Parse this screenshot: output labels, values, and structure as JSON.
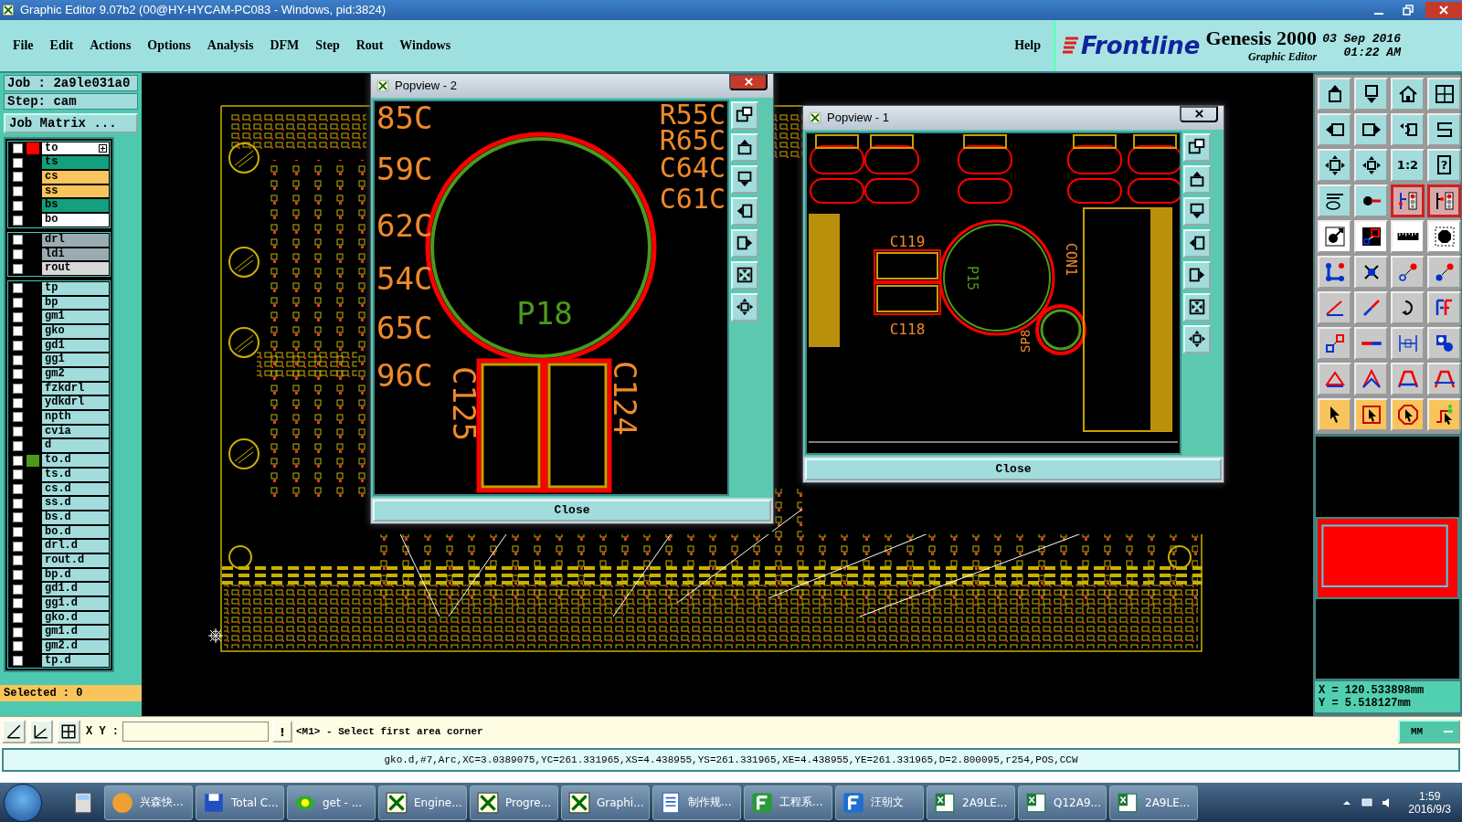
{
  "window": {
    "title": "Graphic Editor 9.07b2 (00@HY-HYCAM-PC083 - Windows, pid:3824)"
  },
  "menu": [
    "File",
    "Edit",
    "Actions",
    "Options",
    "Analysis",
    "DFM",
    "Step",
    "Rout",
    "Windows"
  ],
  "help": "Help",
  "brand": {
    "logo": "Frontline",
    "product": "Genesis 2000",
    "subtitle": "Graphic Editor",
    "date": "03 Sep 2016",
    "time": "01:22 AM"
  },
  "job": {
    "job": "Job : 2a9le031a0",
    "step": "Step: cam",
    "matrix_button": "Job Matrix ..."
  },
  "layer_groups": [
    [
      {
        "name": "to",
        "color": "#ffffff",
        "checked": false,
        "marker": {
          "color": "#ff0000"
        }
      },
      {
        "name": "ts",
        "color": "#13a07c",
        "checked": false
      },
      {
        "name": "cs",
        "color": "#f8c45c",
        "checked": false
      },
      {
        "name": "ss",
        "color": "#f8c45c",
        "checked": false
      },
      {
        "name": "bs",
        "color": "#13a07c",
        "checked": false
      },
      {
        "name": "bo",
        "color": "#ffffff",
        "checked": false
      }
    ],
    [
      {
        "name": "drl",
        "color": "#9aacb2",
        "checked": false
      },
      {
        "name": "ldi",
        "color": "#9aacb2",
        "checked": false
      },
      {
        "name": "rout",
        "color": "#d8d8d8",
        "checked": false
      }
    ],
    [
      {
        "name": "tp",
        "color": "#a2dcdc",
        "checked": false
      },
      {
        "name": "bp",
        "color": "#a2dcdc",
        "checked": false
      },
      {
        "name": "gm1",
        "color": "#a2dcdc",
        "checked": false
      },
      {
        "name": "gko",
        "color": "#a2dcdc",
        "checked": false
      },
      {
        "name": "gd1",
        "color": "#a2dcdc",
        "checked": false
      },
      {
        "name": "gg1",
        "color": "#a2dcdc",
        "checked": false
      },
      {
        "name": "gm2",
        "color": "#a2dcdc",
        "checked": false
      },
      {
        "name": "fzkdrl",
        "color": "#a2dcdc",
        "checked": false
      },
      {
        "name": "ydkdrl",
        "color": "#a2dcdc",
        "checked": false
      },
      {
        "name": "npth",
        "color": "#a2dcdc",
        "checked": false
      },
      {
        "name": "cvia",
        "color": "#a2dcdc",
        "checked": false
      },
      {
        "name": "d",
        "color": "#a2dcdc",
        "checked": false
      },
      {
        "name": "to.d",
        "color": "#a2dcdc",
        "checked": false,
        "marker": {
          "color": "#4c9a1a"
        }
      },
      {
        "name": "ts.d",
        "color": "#a2dcdc",
        "checked": false
      },
      {
        "name": "cs.d",
        "color": "#a2dcdc",
        "checked": false
      },
      {
        "name": "ss.d",
        "color": "#a2dcdc",
        "checked": false
      },
      {
        "name": "bs.d",
        "color": "#a2dcdc",
        "checked": false
      },
      {
        "name": "bo.d",
        "color": "#a2dcdc",
        "checked": false
      },
      {
        "name": "drl.d",
        "color": "#a2dcdc",
        "checked": false
      },
      {
        "name": "rout.d",
        "color": "#a2dcdc",
        "checked": false
      },
      {
        "name": "bp.d",
        "color": "#a2dcdc",
        "checked": false
      },
      {
        "name": "gd1.d",
        "color": "#a2dcdc",
        "checked": false
      },
      {
        "name": "gg1.d",
        "color": "#a2dcdc",
        "checked": false
      },
      {
        "name": "gko.d",
        "color": "#a2dcdc",
        "checked": false
      },
      {
        "name": "gm1.d",
        "color": "#a2dcdc",
        "checked": false
      },
      {
        "name": "gm2.d",
        "color": "#a2dcdc",
        "checked": false
      },
      {
        "name": "tp.d",
        "color": "#a2dcdc",
        "checked": false
      }
    ]
  ],
  "selected_count": "Selected : 0",
  "popviews": [
    {
      "title": "Popview - 2",
      "kind": "pads",
      "left_labels": [
        "85C",
        "59C",
        "62C",
        "54C",
        "65C",
        "96C"
      ],
      "right_labels": [
        "R55C",
        "R65C",
        "C64C",
        "C61C"
      ],
      "circle_label": "P18",
      "pad_labels": [
        "C125",
        "C124"
      ],
      "close": "Close"
    },
    {
      "title": "Popview - 1",
      "kind": "connector",
      "cap_labels": [
        "C119",
        "C118"
      ],
      "circle_label": "P15",
      "connector_label": "CON1",
      "small_circle_label": "SP8",
      "close": "Close"
    }
  ],
  "tools": [
    {
      "kind": "view",
      "selected": false
    },
    {
      "kind": "view",
      "selected": false
    },
    {
      "kind": "view",
      "selected": false
    },
    {
      "kind": "view",
      "selected": false
    },
    {
      "kind": "view",
      "selected": false
    },
    {
      "kind": "view",
      "selected": false
    },
    {
      "kind": "view",
      "selected": false
    },
    {
      "kind": "view",
      "selected": false
    },
    {
      "kind": "view",
      "selected": false
    },
    {
      "kind": "view",
      "selected": false
    },
    {
      "kind": "view",
      "selected": false,
      "label": "1:2"
    },
    {
      "kind": "view",
      "selected": false,
      "label": "?"
    },
    {
      "kind": "view",
      "selected": false
    },
    {
      "kind": "view",
      "selected": false
    },
    {
      "kind": "view",
      "selected": true
    },
    {
      "kind": "view",
      "selected": true
    },
    {
      "kind": "toggle",
      "selected": false
    },
    {
      "kind": "toggle",
      "selected": false
    },
    {
      "kind": "toggle",
      "selected": false
    },
    {
      "kind": "toggle",
      "selected": false
    },
    {
      "kind": "edit",
      "selected": false
    },
    {
      "kind": "edit",
      "selected": false
    },
    {
      "kind": "edit",
      "selected": false
    },
    {
      "kind": "edit",
      "selected": false
    },
    {
      "kind": "edit",
      "selected": false
    },
    {
      "kind": "edit",
      "selected": false
    },
    {
      "kind": "edit",
      "selected": false
    },
    {
      "kind": "edit",
      "selected": false
    },
    {
      "kind": "edit",
      "selected": false
    },
    {
      "kind": "edit",
      "selected": false
    },
    {
      "kind": "edit",
      "selected": false
    },
    {
      "kind": "edit",
      "selected": false
    },
    {
      "kind": "edit",
      "selected": false
    },
    {
      "kind": "edit",
      "selected": false
    },
    {
      "kind": "edit",
      "selected": false
    },
    {
      "kind": "edit",
      "selected": false
    },
    {
      "kind": "select",
      "selected": false
    },
    {
      "kind": "select",
      "selected": false
    },
    {
      "kind": "select",
      "selected": false
    },
    {
      "kind": "select",
      "selected": false
    }
  ],
  "coordinates": {
    "x": "X = 120.533898mm",
    "y": "Y = 5.518127mm"
  },
  "command": {
    "xy_label": "X Y :",
    "bang": "!",
    "prompt": "<M1> - Select first area corner",
    "units": "MM"
  },
  "status": "gko.d,#7,Arc,XC=3.0389075,YC=261.331965,XS=4.438955,YS=261.331965,XE=4.438955,YE=261.331965,D=2.800095,r254,POS,CCW",
  "taskbar": {
    "items": [
      {
        "label": "兴森快..."
      },
      {
        "label": "Total C..."
      },
      {
        "label": "get - ..."
      },
      {
        "label": "Engine..."
      },
      {
        "label": "Progre..."
      },
      {
        "label": "Graphi..."
      },
      {
        "label": "制作规..."
      },
      {
        "label": "工程系..."
      },
      {
        "label": "汪朝文"
      },
      {
        "label": "2A9LE..."
      },
      {
        "label": "Q12A9..."
      },
      {
        "label": "2A9LE..."
      }
    ],
    "clock": {
      "time": "1:59",
      "date": "2016/9/3"
    }
  }
}
